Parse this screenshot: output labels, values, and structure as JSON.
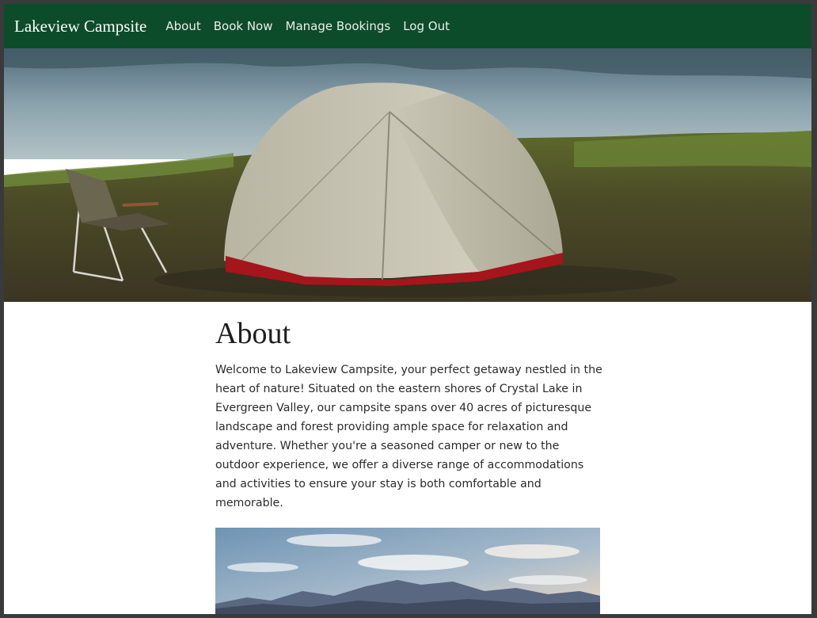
{
  "navbar": {
    "brand": "Lakeview Campsite",
    "links": [
      "About",
      "Book Now",
      "Manage Bookings",
      "Log Out"
    ],
    "background": "#0d4c2a"
  },
  "hero": {
    "alt": "Tent and camping chair by the lake"
  },
  "main": {
    "title": "About",
    "paragraph": "Welcome to Lakeview Campsite, your perfect getaway nestled in the heart of nature! Situated on the eastern shores of Crystal Lake in Evergreen Valley, our campsite spans over 40 acres of picturesque landscape and forest providing ample space for relaxation and adventure. Whether you're a seasoned camper or new to the outdoor experience, we offer a diverse range of accommodations and activities to ensure your stay is both comfortable and memorable.",
    "image_alt": "Mountain range under a cloudy sky"
  }
}
